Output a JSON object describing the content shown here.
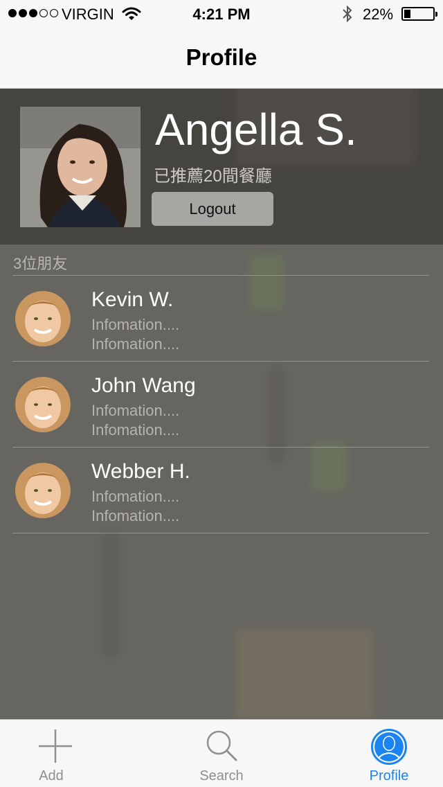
{
  "status_bar": {
    "carrier": "VIRGIN",
    "time": "4:21 PM",
    "battery_percent": "22%",
    "battery_level": 0.22,
    "signal_bars_filled": 3,
    "signal_bars_total": 5
  },
  "nav": {
    "title": "Profile"
  },
  "profile": {
    "name": "Angella S.",
    "recommend_text": "已推薦20間餐廳",
    "logout_label": "Logout"
  },
  "friends": {
    "header": "3位朋友",
    "items": [
      {
        "name": "Kevin W.",
        "info1": "Infomation....",
        "info2": "Infomation...."
      },
      {
        "name": "John Wang",
        "info1": "Infomation....",
        "info2": "Infomation...."
      },
      {
        "name": "Webber H.",
        "info1": "Infomation....",
        "info2": "Infomation...."
      }
    ]
  },
  "tabbar": {
    "tabs": [
      {
        "label": "Add",
        "icon": "plus-icon",
        "active": false
      },
      {
        "label": "Search",
        "icon": "search-icon",
        "active": false
      },
      {
        "label": "Profile",
        "icon": "profile-icon",
        "active": true
      }
    ]
  },
  "colors": {
    "accent": "#1a84f0",
    "bar_bg": "#f7f7f7",
    "overlay": "#37342f"
  }
}
